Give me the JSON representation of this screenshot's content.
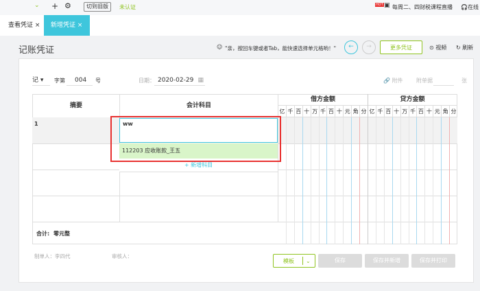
{
  "topbar": {
    "switch_old": "切到旧版",
    "unverified": "未认证",
    "hot_badge": "HOT",
    "live_text": "每周二、四财税课程直播",
    "online": "在线"
  },
  "tabs": [
    {
      "label": "查看凭证",
      "active": false
    },
    {
      "label": "新增凭证",
      "active": true
    }
  ],
  "page": {
    "title": "记账凭证",
    "tip": "\"亲，按回车键或者Tab，能快速选择单元格哟！\"",
    "more_label": "更多凭证",
    "video_label": "视频",
    "refresh_label": "刷新"
  },
  "form": {
    "word": "记",
    "word_suffix": "字第",
    "number": "004",
    "number_suffix": "号",
    "date_label": "日期：",
    "date": "2020-02-29",
    "attach_label": "附件",
    "bills_label": "附单据",
    "bills_suffix": "张"
  },
  "table": {
    "headers": {
      "summary": "摘要",
      "subject": "会计科目",
      "debit": "借方金额",
      "credit": "贷方金额"
    },
    "digits": [
      "百",
      "十",
      "亿",
      "千",
      "百",
      "十",
      "万",
      "千",
      "百",
      "十",
      "元",
      "角",
      "分"
    ],
    "rows": [
      {
        "no": "1",
        "subject_input": "ww"
      }
    ],
    "suggestion": "112203 应收账款_王五",
    "add_subject": "+ 新增科目",
    "total_label": "合计:",
    "total_value": "零元整"
  },
  "footer": {
    "maker": "制单人：李四代",
    "reviewer": "审核人：",
    "template": "模板",
    "save": "保存",
    "save_new": "保存并新增",
    "save_print": "保存并打印"
  },
  "colors": {
    "accent": "#3ec6dc",
    "green": "#8fc31f",
    "highlight": "#e8302f"
  }
}
